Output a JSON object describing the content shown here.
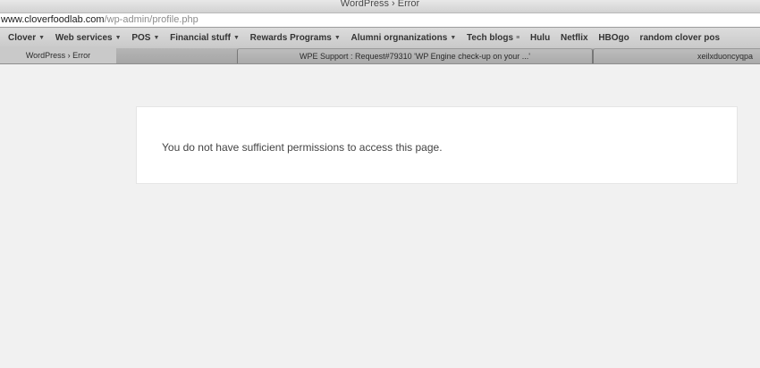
{
  "window": {
    "title": "WordPress › Error"
  },
  "address": {
    "domain": "www.cloverfoodlab.com",
    "path": "/wp-admin/profile.php"
  },
  "bookmarks": [
    {
      "label": "Clover",
      "dropdown": true
    },
    {
      "label": "Web services",
      "dropdown": true
    },
    {
      "label": "POS",
      "dropdown": true
    },
    {
      "label": "Financial stuff",
      "dropdown": true
    },
    {
      "label": "Rewards Programs",
      "dropdown": true
    },
    {
      "label": "Alumni orgnanizations",
      "dropdown": true
    },
    {
      "label": "Tech blogs",
      "dropdown": false,
      "menu": true
    },
    {
      "label": "Hulu",
      "dropdown": false
    },
    {
      "label": "Netflix",
      "dropdown": false
    },
    {
      "label": "HBOgo",
      "dropdown": false
    },
    {
      "label": "random clover pos",
      "dropdown": false
    }
  ],
  "tabs": [
    {
      "label": "WordPress › Error",
      "active": true
    },
    {
      "label": "WPE Support : Request#79310 'WP Engine check-up on your ...'",
      "active": false
    },
    {
      "label": "xeilxduoncyqpa",
      "active": false
    }
  ],
  "main": {
    "error_message": "You do not have sufficient permissions to access this page."
  }
}
